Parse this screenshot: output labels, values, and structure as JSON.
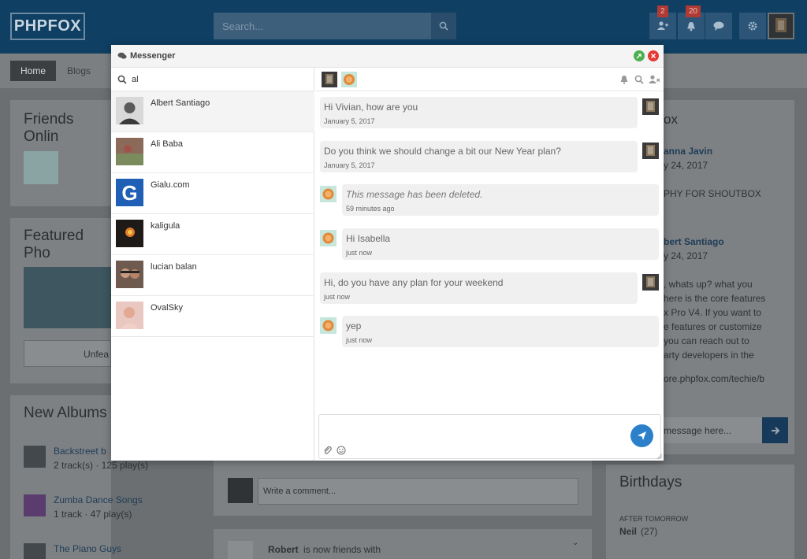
{
  "site": {
    "logo": "PHPFOX",
    "search_placeholder": "Search...",
    "friend_badge": "2",
    "notif_badge": "20",
    "nav": {
      "home": "Home",
      "blogs": "Blogs"
    }
  },
  "bg": {
    "friends_online": "Friends Onlin",
    "featured": "Featured Pho",
    "unfeature": "Unfea",
    "new_albums": "New Albums",
    "albums": [
      {
        "title": "Backstreet b",
        "meta": "2 track(s)  ·  125 play(s)"
      },
      {
        "title": "Zumba Dance Songs",
        "meta": "1 track  ·  47 play(s)"
      },
      {
        "title": "The Piano Guys",
        "meta": ""
      }
    ],
    "shoutbox_title": "ox",
    "shout1_name": "anna Javin",
    "shout1_date": "y 24, 2017",
    "shout1_text": "PHY FOR SHOUTBOX",
    "shout2_name": "bert Santiago",
    "shout2_date": "y 24, 2017",
    "shout2_lines": [
      ", whats up? what you",
      "here is the core features",
      "x Pro V4. If you want to",
      "e features or customize",
      " you can reach out to",
      "arty developers in the",
      "",
      "ore.phpfox.com/techie/b"
    ],
    "shout_input": " message here...",
    "comment_placeholder": "Write a comment...",
    "feed_name": "Robert",
    "feed_text": "is now friends with",
    "birthdays": "Birthdays",
    "after_tomorrow": "AFTER TOMORROW",
    "bday_name": "Neil",
    "bday_age": "(27)"
  },
  "messenger": {
    "title": "Messenger",
    "search_value": "al",
    "contacts": [
      {
        "name": "Albert Santiago"
      },
      {
        "name": "Ali Baba"
      },
      {
        "name": "Gialu.com"
      },
      {
        "name": "kaligula"
      },
      {
        "name": "lucian balan"
      },
      {
        "name": "OvalSky"
      }
    ],
    "messages": [
      {
        "text": "Hi Vivian, how are you",
        "time": "January 5, 2017",
        "side": "right"
      },
      {
        "text": "Do you think we should change a bit our New Year plan?",
        "time": "January 5, 2017",
        "side": "right"
      },
      {
        "text": "This message has been deleted.",
        "time": "59 minutes ago",
        "side": "left"
      },
      {
        "text": "Hi Isabella",
        "time": "just now",
        "side": "left"
      },
      {
        "text": "Hi, do you have any plan for your weekend",
        "time": "just now",
        "side": "right"
      },
      {
        "text": "yep",
        "time": "just now",
        "side": "left"
      }
    ]
  },
  "colors": {
    "accent": "#2b80c9",
    "topbar": "#0f3f63",
    "minimize": "#4caf50",
    "close": "#e53935"
  }
}
